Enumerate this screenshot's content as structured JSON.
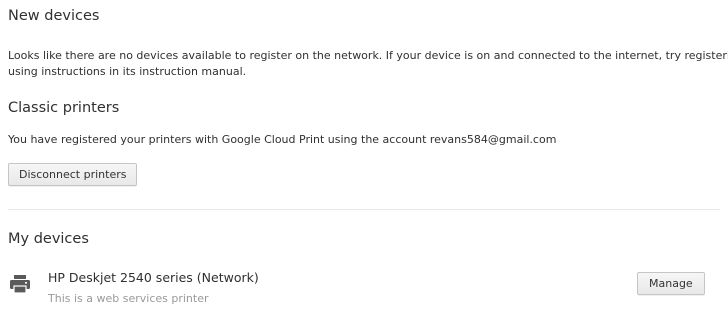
{
  "new_devices": {
    "title": "New devices",
    "message_line1": "Looks like there are no devices available to register on the network. If your device is on and connected to the internet, try registering it",
    "message_line2": "using instructions in its instruction manual."
  },
  "classic_printers": {
    "title": "Classic printers",
    "message": "You have registered your printers with Google Cloud Print using the account revans584@gmail.com",
    "disconnect_label": "Disconnect printers"
  },
  "my_devices": {
    "title": "My devices",
    "devices": [
      {
        "icon": "printer-icon",
        "name": "HP Deskjet 2540 series (Network)",
        "description": "This is a web services printer",
        "manage_label": "Manage"
      }
    ]
  },
  "colors": {
    "text": "#303030",
    "muted": "#999999",
    "divider": "#e8e8e8"
  }
}
